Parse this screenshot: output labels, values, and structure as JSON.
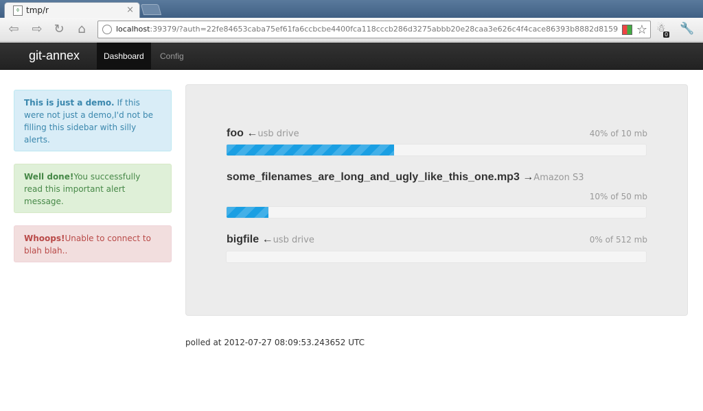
{
  "browser": {
    "tab_title": "tmp/r",
    "url_host": "localhost",
    "url_rest": ":39379/?auth=22fe84653caba75ef61fa6ccbcbe4400fca118cccb286d3275abbb20e28caa3e626c4f4cace86393b8882d8159",
    "extension_badge": "0"
  },
  "navbar": {
    "brand": "git-annex",
    "items": [
      {
        "label": "Dashboard",
        "active": true
      },
      {
        "label": "Config",
        "active": false
      }
    ]
  },
  "alerts": [
    {
      "type": "info",
      "title": "This is just a demo.",
      "body": " If this were not just a demo,I'd not be filling this sidebar with silly alerts."
    },
    {
      "type": "success",
      "title": "Well done!",
      "body": "You successfully read this important alert message."
    },
    {
      "type": "error",
      "title": "Whoops!",
      "body": "Unable to connect to blah blah.."
    }
  ],
  "transfers": [
    {
      "name": "foo",
      "arrow": "←",
      "remote": "usb drive",
      "progress_text": "40% of 10 mb",
      "progress": 0.4
    },
    {
      "name": "some_filenames_are_long_and_ugly_like_this_one.mp3",
      "arrow": "→",
      "remote": "Amazon S3",
      "progress_text": "10% of 50 mb",
      "progress": 0.1
    },
    {
      "name": "bigfile",
      "arrow": "←",
      "remote": "usb drive",
      "progress_text": "0% of 512 mb",
      "progress": 0.0
    }
  ],
  "status": {
    "polled": "polled at 2012-07-27 08:09:53.243652 UTC"
  },
  "colors": {
    "progress_fill": "#1a9fe3",
    "navbar": "#222222"
  }
}
